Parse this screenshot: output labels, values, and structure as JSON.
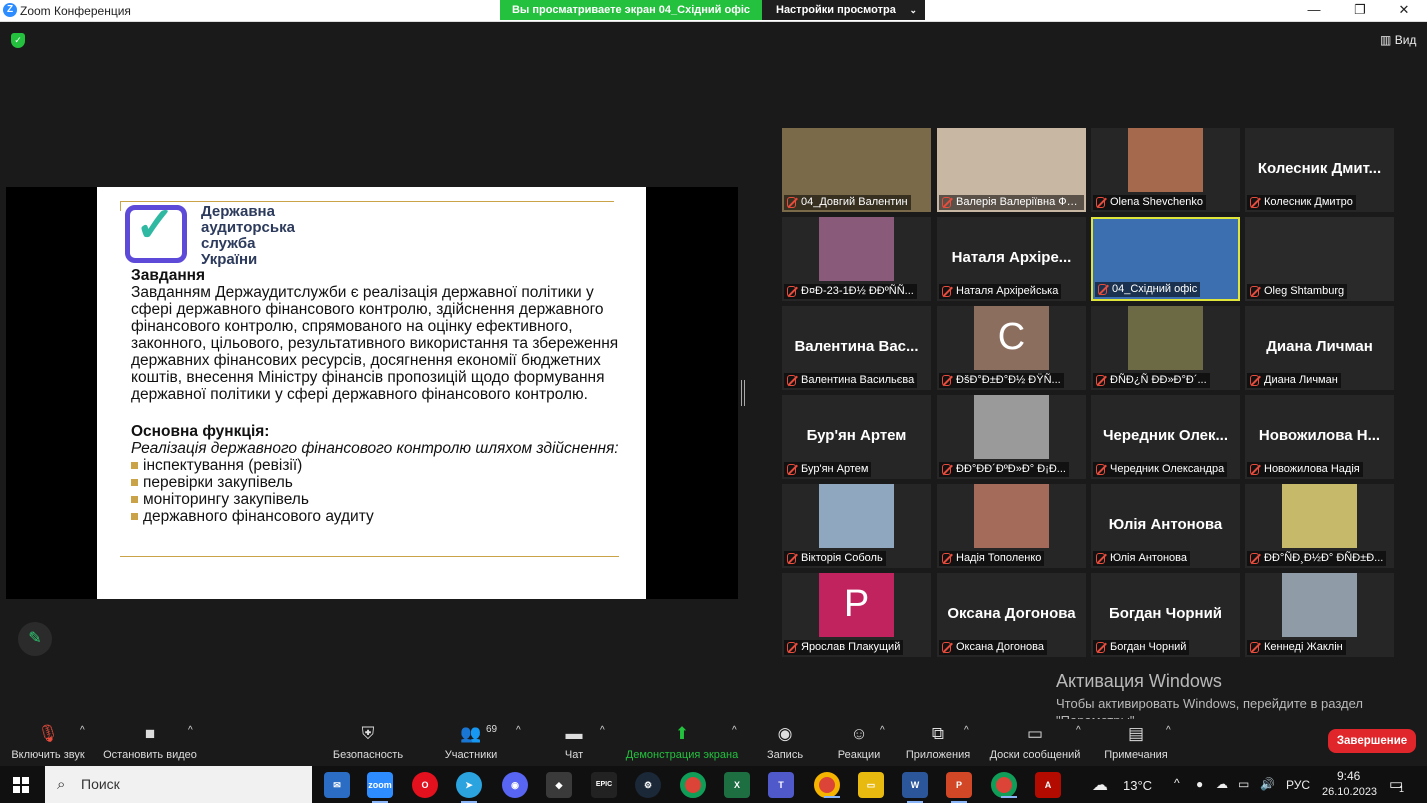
{
  "titlebar": {
    "app_title": "Zoom Конференция",
    "share_banner": "Вы просматриваете экран 04_Східний офіс",
    "view_settings": "Настройки просмотра",
    "minimize": "—",
    "maximize": "❐",
    "close": "✕"
  },
  "top_right": {
    "view_label": "Вид"
  },
  "slide": {
    "org_name": "Державна\nаудиторська\nслужба\nУкраїни",
    "task_heading": "Завдання",
    "task_body": "Завданням Держаудитслужби є реалізація державної політики у сфері державного фінансового контролю, здійснення державного фінансового контролю, спрямованого на оцінку ефективного, законного, цільового, результативного використання та збереження державних фінансових ресурсів, досягнення економії бюджетних коштів, внесення Міністру фінансів пропозицій щодо формування державної політики у сфері державного фінансового контролю.",
    "function_heading": "Основна функція:",
    "function_intro": "Реалізація державного фінансового контролю шляхом здійснення:",
    "bullets": [
      "інспектування (ревізії)",
      "перевірки закупівель",
      "моніторингу закупівель",
      "державного фінансового аудиту"
    ]
  },
  "participants": [
    {
      "label": "04_Довгий Валентин",
      "display": "",
      "photo": "#7a6a4a"
    },
    {
      "label": "Валерія Валеріївна Фе...",
      "display": "",
      "photo": "#c8b7a2"
    },
    {
      "label": "Olena Shevchenko",
      "display": "",
      "photo": "#a56a4e"
    },
    {
      "label": "Колесник Дмитро",
      "display": "Колесник Дмит...",
      "photo": ""
    },
    {
      "label": "Ð¤Ð-23-1Ð½ ÐÐºÑÑ...",
      "display": "",
      "photo": "#8a5a7a"
    },
    {
      "label": "Наталя Архірейська",
      "display": "Наталя Архіре...",
      "photo": ""
    },
    {
      "label": "04_Східний офіс",
      "display": "",
      "photo": "#3b6fb0"
    },
    {
      "label": "Oleg Shtamburg",
      "display": "",
      "photo": "#2a2a2a"
    },
    {
      "label": "Валентина Васильєва",
      "display": "Валентина Вас...",
      "photo": ""
    },
    {
      "label": "ÐšÐ°Ð±Ð°Ð½ ÐŸÑ...",
      "display": "C",
      "photo": "#8c6e5f"
    },
    {
      "label": "ÐÑÐ¿Ñ ÐÐ»Ð°Ð´...",
      "display": "",
      "photo": "#6b6a45"
    },
    {
      "label": "Диана Личман",
      "display": "Диана Личман",
      "photo": ""
    },
    {
      "label": "Бур'ян Артем",
      "display": "Бур'ян Артем",
      "photo": ""
    },
    {
      "label": "ÐÐ°ÐÐ´ÐºÐ»Ð° Ð¡Ð...",
      "display": "",
      "photo": "#9a9a9a"
    },
    {
      "label": "Чередник Олександра",
      "display": "Чередник Олек...",
      "photo": ""
    },
    {
      "label": "Новожилова Надія",
      "display": "Новожилова Н...",
      "photo": ""
    },
    {
      "label": "Вікторія Соболь",
      "display": "",
      "photo": "#8fa8c0"
    },
    {
      "label": "Надія Тополенко",
      "display": "",
      "photo": "#a46a5a"
    },
    {
      "label": "Юлія Антонова",
      "display": "Юлія Антонова",
      "photo": ""
    },
    {
      "label": "ÐÐ°ÑÐ¸Ð½Ð° ÐÑÐ±Ð...",
      "display": "",
      "photo": "#c7b96a"
    },
    {
      "label": "Ярослав Плакущий",
      "display": "P",
      "photo": "#c0235e"
    },
    {
      "label": "Оксана Догонова",
      "display": "Оксана Догонова",
      "photo": ""
    },
    {
      "label": "Богдан Чорний",
      "display": "Богдан Чорний",
      "photo": ""
    },
    {
      "label": "Кеннеді Жаклін",
      "display": "",
      "photo": "#8f9ca8"
    }
  ],
  "activation": {
    "title": "Активация Windows",
    "body1": "Чтобы активировать Windows, перейдите в раздел",
    "body2": "\"Параметры\"."
  },
  "toolbar": {
    "unmute": "Включить звук",
    "stop_video": "Остановить видео",
    "security": "Безопасность",
    "participants": "Участники",
    "participants_count": "69",
    "chat": "Чат",
    "share_screen": "Демонстрация экрана",
    "record": "Запись",
    "reactions": "Реакции",
    "apps": "Приложения",
    "whiteboards": "Доски сообщений",
    "notes": "Примечания",
    "end": "Завершение"
  },
  "taskbar": {
    "search_placeholder": "Поиск",
    "weather": "13°C",
    "lang": "РУС",
    "time": "9:46",
    "date": "26.10.2023",
    "zoom_label": "zoom",
    "epic_label": "EPIC",
    "notif_count": "1"
  }
}
